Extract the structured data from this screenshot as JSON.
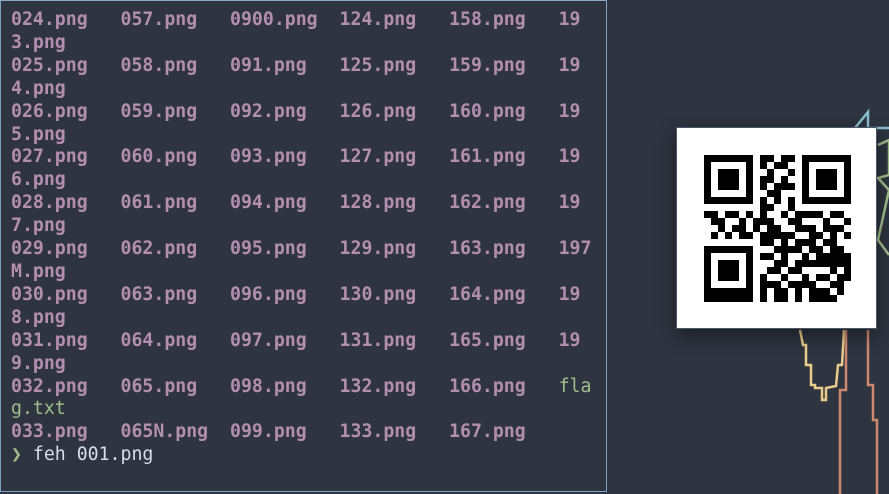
{
  "terminal": {
    "rows": [
      [
        "024.png",
        "057.png",
        "0900.png",
        "124.png",
        "158.png",
        "193.png"
      ],
      [
        "025.png",
        "058.png",
        "091.png",
        "125.png",
        "159.png",
        "194.png"
      ],
      [
        "026.png",
        "059.png",
        "092.png",
        "126.png",
        "160.png",
        "195.png"
      ],
      [
        "027.png",
        "060.png",
        "093.png",
        "127.png",
        "161.png",
        "196.png"
      ],
      [
        "028.png",
        "061.png",
        "094.png",
        "128.png",
        "162.png",
        "197.png"
      ],
      [
        "029.png",
        "062.png",
        "095.png",
        "129.png",
        "163.png",
        "197M.png"
      ],
      [
        "030.png",
        "063.png",
        "096.png",
        "130.png",
        "164.png",
        "198.png"
      ],
      [
        "031.png",
        "064.png",
        "097.png",
        "131.png",
        "165.png",
        "199.png"
      ],
      [
        "032.png",
        "065.png",
        "098.png",
        "132.png",
        "166.png",
        "flag.txt"
      ],
      [
        "033.png",
        "065N.png",
        "099.png",
        "133.png",
        "167.png"
      ]
    ],
    "prompt_symbol": "❯",
    "command": "feh 001.png"
  },
  "colors": {
    "background": "#2e3440",
    "png": "#b48ead",
    "txt": "#a3be8c",
    "border": "#81a1c1"
  },
  "image_viewer": {
    "content": "qr-code"
  }
}
